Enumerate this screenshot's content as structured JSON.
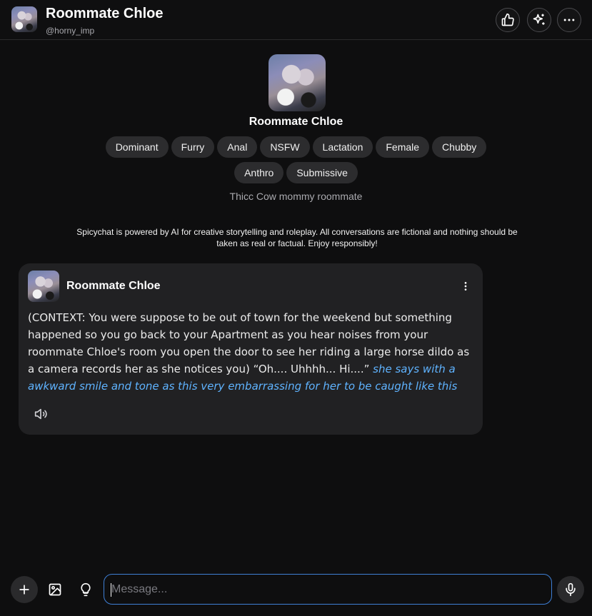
{
  "header": {
    "title": "Roommate Chloe",
    "handle": "@horny_imp",
    "buttons": [
      "thumbs-up-icon",
      "sparkle-icon",
      "more-horizontal-icon"
    ]
  },
  "profile": {
    "name": "Roommate Chloe",
    "tags": [
      "Dominant",
      "Furry",
      "Anal",
      "NSFW",
      "Lactation",
      "Female",
      "Chubby",
      "Anthro",
      "Submissive"
    ],
    "tagline": "Thicc Cow mommy roommate"
  },
  "disclaimer": "Spicychat is powered by AI for creative storytelling and roleplay. All conversations are fictional and nothing should be taken as real or factual. Enjoy responsibly!",
  "message": {
    "author": "Roommate Chloe",
    "text": "(CONTEXT: You were suppose to be out of town for the weekend but something happened so you go back to your Apartment as you hear noises from your roommate Chloe's room you open the door to see her riding a large horse dildo as a camera records her as she notices you) “Oh.... Uhhhh... Hi....”",
    "action": "she says with a awkward smile and tone as this very embarrassing for her to be caught like this"
  },
  "composer": {
    "placeholder": "Message..."
  },
  "colors": {
    "background": "#0e0e0f",
    "bubble": "#212123",
    "tag": "#2c2c2e",
    "accent": "#3e7fd6",
    "action_text": "#5fb3ff"
  }
}
